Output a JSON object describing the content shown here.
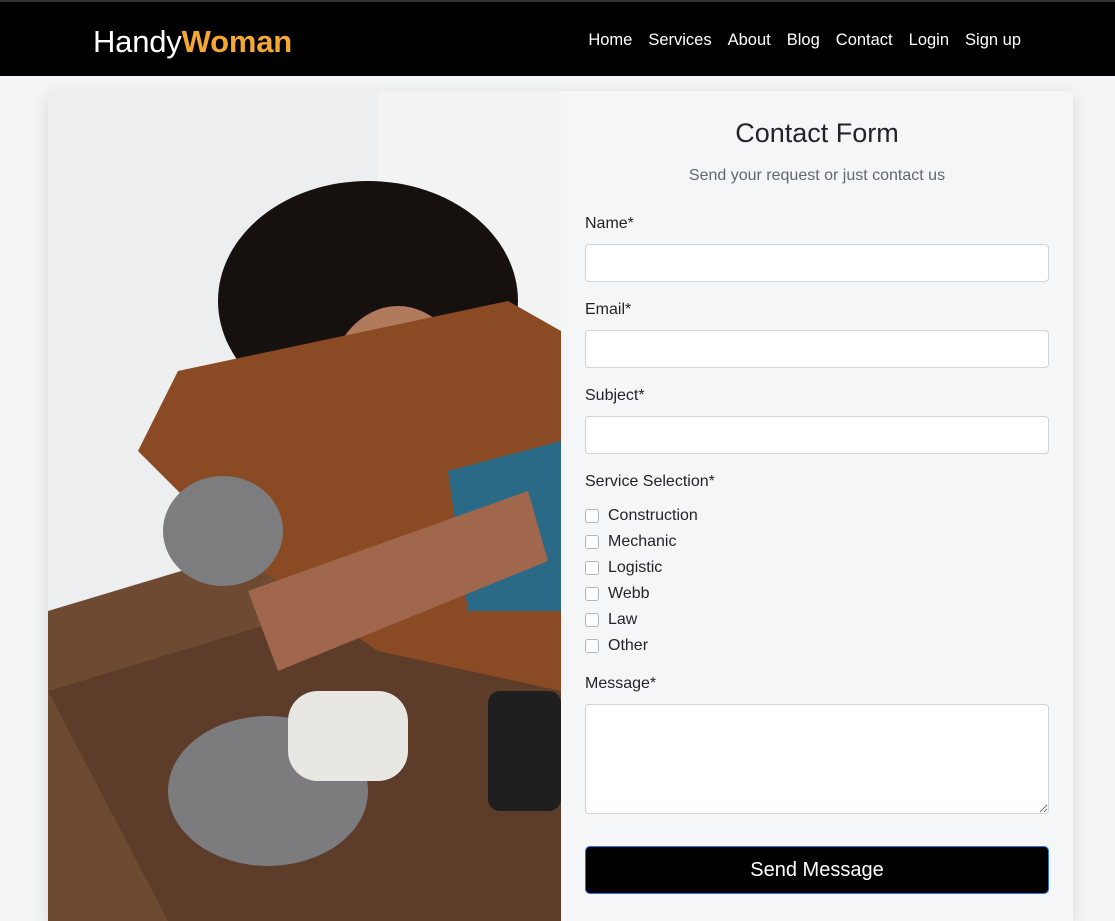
{
  "brand": {
    "part1": "Handy",
    "part2": "Woman",
    "accent_color": "#f5a733"
  },
  "nav": {
    "items": [
      {
        "label": "Home"
      },
      {
        "label": "Services"
      },
      {
        "label": "About"
      },
      {
        "label": "Blog"
      },
      {
        "label": "Contact"
      },
      {
        "label": "Login"
      },
      {
        "label": "Sign up"
      }
    ]
  },
  "hero_image": {
    "description_icon": "woodworker-photo"
  },
  "form": {
    "title": "Contact Form",
    "subtitle": "Send your request or just contact us",
    "name_label": "Name*",
    "name_value": "",
    "email_label": "Email*",
    "email_value": "",
    "subject_label": "Subject*",
    "subject_value": "",
    "service_label": "Service Selection*",
    "services": [
      {
        "label": "Construction",
        "checked": false
      },
      {
        "label": "Mechanic",
        "checked": false
      },
      {
        "label": "Logistic",
        "checked": false
      },
      {
        "label": "Webb",
        "checked": false
      },
      {
        "label": "Law",
        "checked": false
      },
      {
        "label": "Other",
        "checked": false
      }
    ],
    "message_label": "Message*",
    "message_value": "",
    "submit_label": "Send Message"
  },
  "colors": {
    "navbar": "#000000",
    "button": "#000000",
    "button_border": "#2f6fd6"
  }
}
